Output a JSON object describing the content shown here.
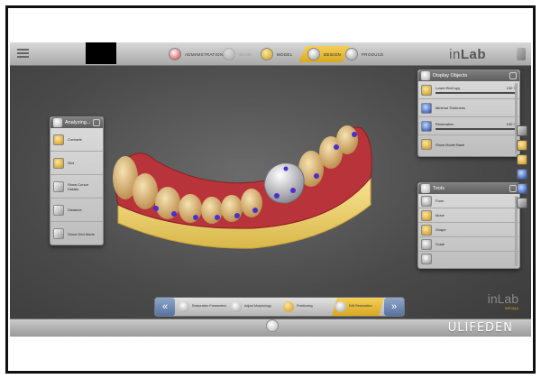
{
  "topbar": {
    "steps": [
      {
        "label": "ADMINISTRATION",
        "icon": "admin-icon"
      },
      {
        "label": "SCAN",
        "icon": "scan-icon"
      },
      {
        "label": "MODEL",
        "icon": "model-icon"
      },
      {
        "label": "DESIGN",
        "icon": "design-icon",
        "active": true
      },
      {
        "label": "PRODUCE",
        "icon": "produce-icon"
      }
    ],
    "brand_in": "in",
    "brand_lab": "Lab"
  },
  "analyzing_panel": {
    "title": "Analyzing...",
    "items": [
      {
        "label": "Contacts",
        "icon": "contacts-icon"
      },
      {
        "label": "Slot",
        "icon": "slot-icon"
      },
      {
        "label": "Show Cursor Details",
        "icon": "cursor-details-icon"
      },
      {
        "label": "Distance",
        "icon": "distance-icon"
      },
      {
        "label": "Show Grid Mode",
        "icon": "grid-mode-icon"
      }
    ]
  },
  "display_panel": {
    "title": "Display Objects",
    "items": [
      {
        "label": "Lower BioCopy",
        "value": "100 %",
        "percent": 100
      },
      {
        "label": "Minimal Thickness",
        "value": ""
      },
      {
        "label": "Restoration",
        "value": "100 %",
        "percent": 100
      },
      {
        "label": "Show Model Base",
        "value": ""
      }
    ]
  },
  "tools_panel": {
    "title": "Tools",
    "items": [
      {
        "label": "Form"
      },
      {
        "label": "Move"
      },
      {
        "label": "Shape"
      },
      {
        "label": "Scale"
      },
      {
        "label": ""
      }
    ]
  },
  "workflow": {
    "steps": [
      {
        "label": "Restoration Parameters"
      },
      {
        "label": "Adjust Morphology"
      },
      {
        "label": "Positioning"
      },
      {
        "label": "Edit Restoration",
        "active": true
      }
    ]
  },
  "bottom_brand": {
    "name": "inLab",
    "sub": "SIRONA"
  },
  "watermark": "ULIFEDEN",
  "colors": {
    "accent": "#d9a820",
    "gingiva": "#b8343a",
    "contact": "#4a2fd0"
  }
}
